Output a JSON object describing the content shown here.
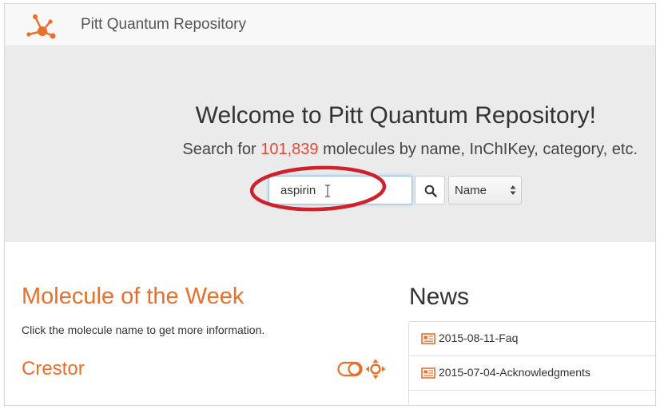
{
  "app": {
    "brand": "Pitt Quantum Repository"
  },
  "hero": {
    "title": "Welcome to Pitt Quantum Repository!",
    "subtitle_before": "Search for",
    "molecule_count": "101,839",
    "subtitle_after": "molecules by name, InChIKey, category, etc."
  },
  "search": {
    "value": "aspirin",
    "button_icon": "search-icon",
    "select_value": "Name"
  },
  "molecule_of_week": {
    "title": "Molecule of the Week",
    "description": "Click the molecule name to get more information.",
    "name": "Crestor",
    "icons": [
      "toggle-icon",
      "move-icon"
    ]
  },
  "news": {
    "title": "News",
    "items": [
      {
        "label": "2015-08-11-Faq",
        "icon": "newspaper-icon"
      },
      {
        "label": "2015-07-04-Acknowledgments",
        "icon": "newspaper-icon"
      }
    ]
  },
  "colors": {
    "accent": "#e8702a",
    "count": "#e04a3a",
    "highlight": "#d0202a",
    "hero_bg": "#ebebeb"
  }
}
